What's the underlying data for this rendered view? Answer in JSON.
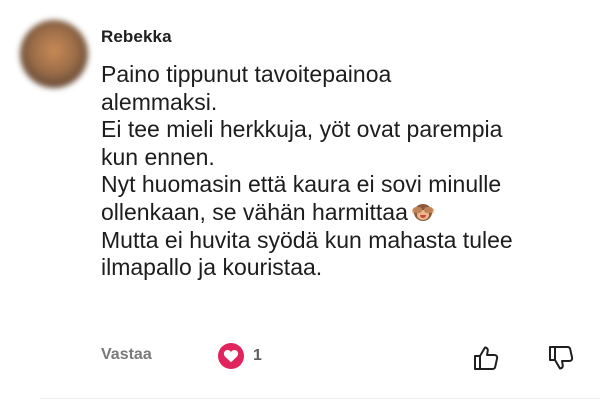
{
  "comment": {
    "author": "Rebekka",
    "lines": [
      "Paino tippunut tavoitepainoa",
      "alemmaksi.",
      "Ei tee mieli herkkuja, yöt ovat parempia",
      "kun ennen.",
      "Nyt huomasin että kaura ei sovi minulle",
      "ollenkaan, se vähän harmittaa",
      "Mutta ei huvita syödä kun mahasta tulee",
      "ilmapallo ja kouristaa."
    ],
    "emoji_icon": "see-no-evil-monkey-icon"
  },
  "actions": {
    "reply_label": "Vastaa",
    "like_count": "1",
    "like_icon": "heart-icon",
    "thumb_up_icon": "thumbs-up-icon",
    "thumb_down_icon": "thumbs-down-icon"
  },
  "colors": {
    "heart": "#e0245e",
    "muted_text": "#7a7a7a",
    "body_text": "#1d1d1d"
  }
}
